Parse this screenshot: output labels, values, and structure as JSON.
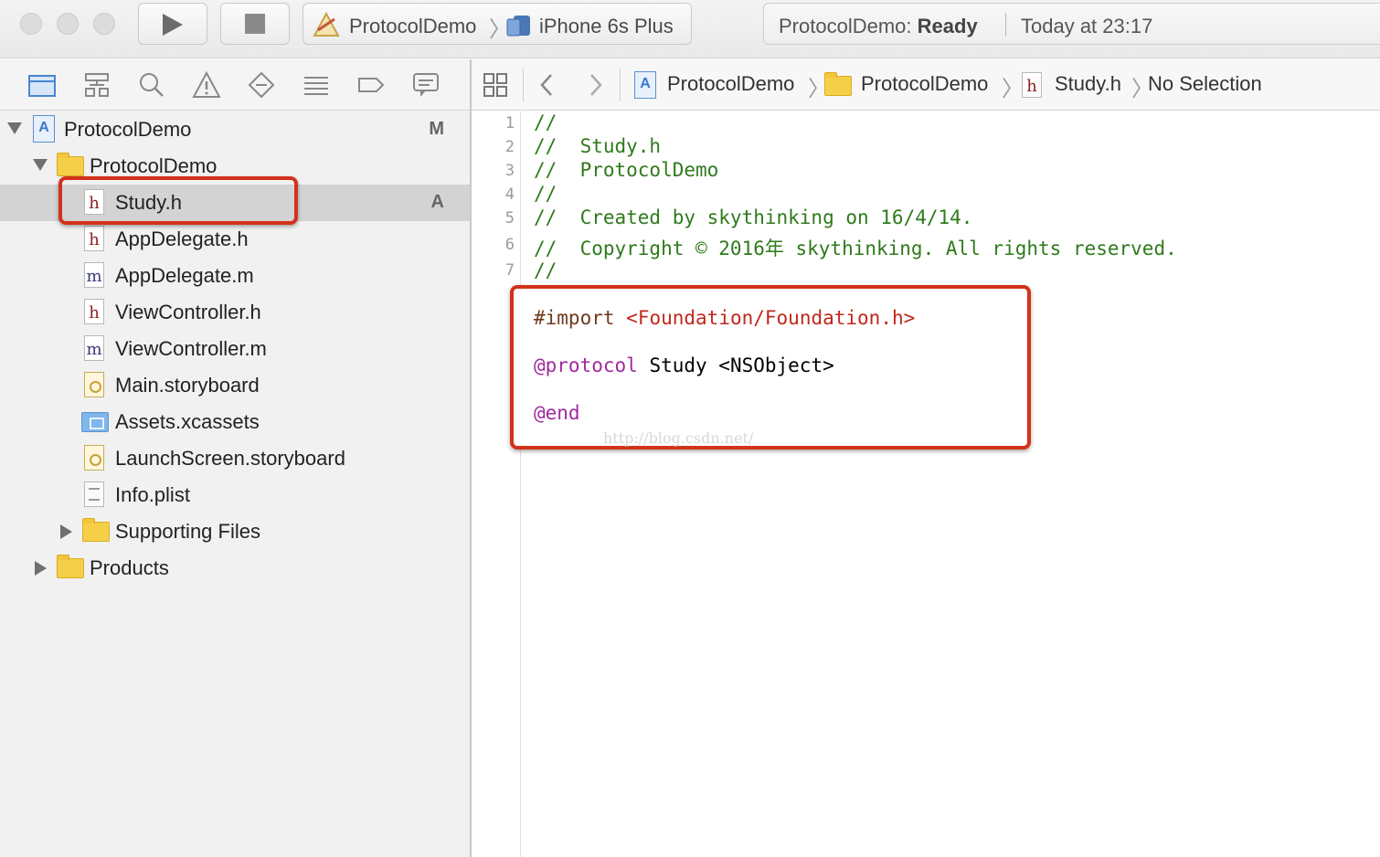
{
  "toolbar": {
    "run_icon": "play-icon",
    "stop_icon": "stop-icon",
    "scheme": {
      "project": "ProtocolDemo",
      "device": "iPhone 6s Plus"
    },
    "status": {
      "prefix": "ProtocolDemo:",
      "state": "Ready",
      "time": "Today at 23:17"
    }
  },
  "navigator": {
    "tabs": [
      "folder-icon",
      "hierarchy-icon",
      "search-icon",
      "warning-icon",
      "breakpoint-diamond-icon",
      "list-icon",
      "tag-icon",
      "speech-bubble-icon"
    ],
    "tree": [
      {
        "label": "ProtocolDemo",
        "badge": "M"
      },
      {
        "label": "ProtocolDemo"
      },
      {
        "label": "Study.h",
        "badge": "A"
      },
      {
        "label": "AppDelegate.h"
      },
      {
        "label": "AppDelegate.m"
      },
      {
        "label": "ViewController.h"
      },
      {
        "label": "ViewController.m"
      },
      {
        "label": "Main.storyboard"
      },
      {
        "label": "Assets.xcassets"
      },
      {
        "label": "LaunchScreen.storyboard"
      },
      {
        "label": "Info.plist"
      },
      {
        "label": "Supporting Files"
      },
      {
        "label": "Products"
      }
    ],
    "file_icon_letters": {
      "header": "h",
      "impl": "m"
    }
  },
  "jumpbar": {
    "crumbs": [
      "ProtocolDemo",
      "ProtocolDemo",
      "Study.h",
      "No Selection"
    ]
  },
  "editor": {
    "line_numbers": [
      "1",
      "2",
      "3",
      "4",
      "5",
      "6",
      "7"
    ],
    "lines": [
      "//",
      "//  Study.h",
      "//  ProtocolDemo",
      "//",
      "//  Created by skythinking on 16/4/14.",
      "//  Copyright © 2016年 skythinking. All rights reserved.",
      "//"
    ],
    "import_kw": "#import",
    "import_path": "<Foundation/Foundation.h>",
    "protocol_kw": "@protocol",
    "protocol_rest": " Study <NSObject>",
    "end_kw": "@end",
    "watermark": "http://blog.csdn.net/"
  },
  "colors": {
    "highlight": "#d2321b",
    "comment": "#2f7a1c",
    "keyword": "#a02aa0",
    "string": "#c0281c"
  }
}
